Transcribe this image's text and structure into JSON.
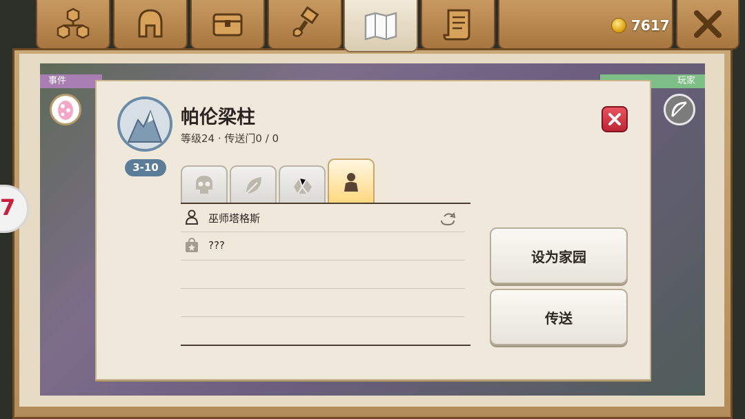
{
  "topbar": {
    "tabs": [
      {
        "icon": "hierarchy-icon"
      },
      {
        "icon": "helmet-icon"
      },
      {
        "icon": "chest-icon"
      },
      {
        "icon": "hammer-icon"
      },
      {
        "icon": "map-icon",
        "active": true
      },
      {
        "icon": "scroll-icon"
      }
    ],
    "coin_count": "7617",
    "close_icon": "close-icon"
  },
  "background": {
    "event_label": "事件",
    "player_label": "玩家",
    "side_badge": "7"
  },
  "panel": {
    "title": "帕伦梁柱",
    "subtitle": "等级24 · 传送门0 / 0",
    "level_range": "3-10",
    "tabs": [
      {
        "icon": "skull-icon"
      },
      {
        "icon": "leaf-icon"
      },
      {
        "icon": "ore-icon"
      },
      {
        "icon": "person-icon",
        "active": true
      }
    ],
    "rows": [
      {
        "icon": "person-outline-icon",
        "text": "巫师塔格斯",
        "action_icon": "teleport-icon"
      },
      {
        "icon": "shop-bag-icon",
        "text": "???"
      }
    ],
    "buttons": {
      "set_home": "设为家园",
      "teleport": "传送"
    }
  },
  "colors": {
    "accent_brown": "#a8763f",
    "level_pill": "#5b7d97",
    "close_red": "#c02434",
    "active_tab": "#ffd77d"
  }
}
